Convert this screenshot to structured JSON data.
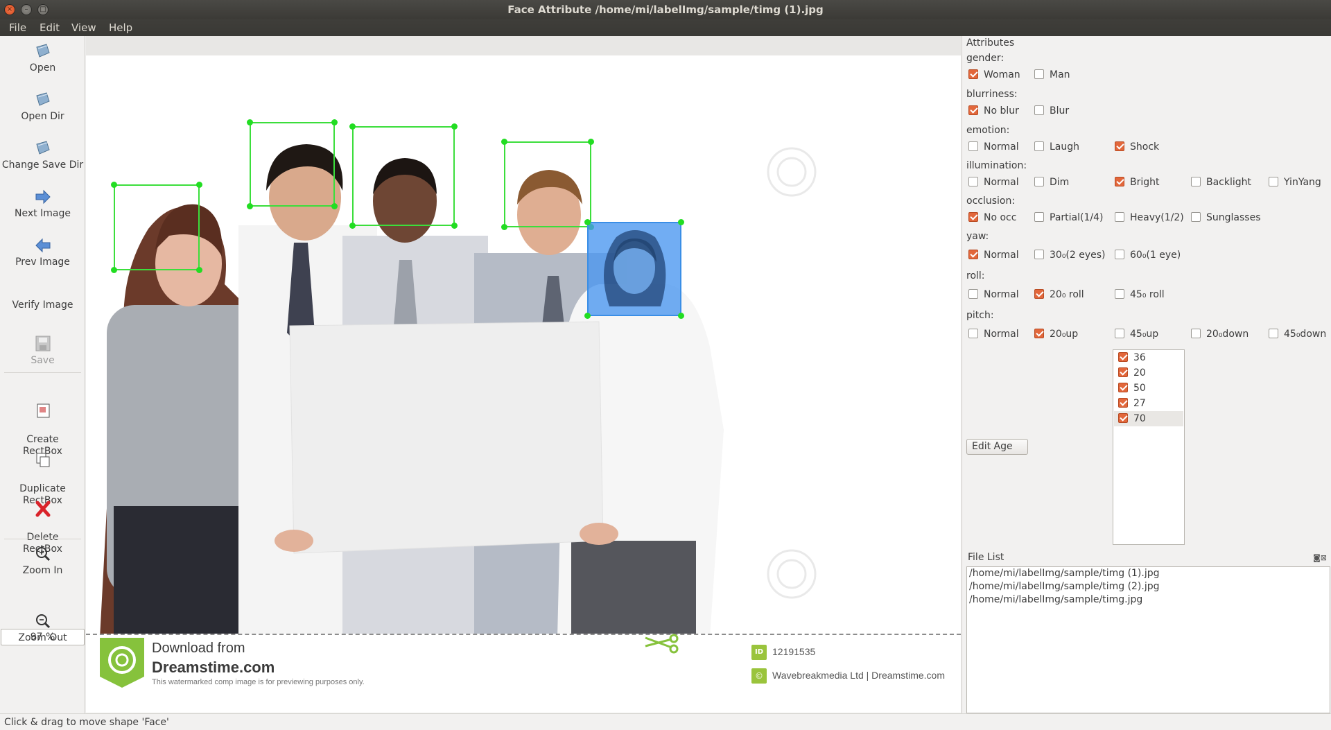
{
  "window": {
    "title": "Face Attribute /home/mi/labelImg/sample/timg (1).jpg",
    "close_glyph": "×",
    "minimize_glyph": "–",
    "maximize_glyph": "□"
  },
  "menu": {
    "file": "File",
    "edit": "Edit",
    "view": "View",
    "help": "Help"
  },
  "toolbar": {
    "open": "Open",
    "open_dir": "Open Dir",
    "change_save_dir": "Change Save Dir",
    "next_image": "Next Image",
    "prev_image": "Prev Image",
    "verify_image": "Verify Image",
    "save": "Save",
    "create_rectbox": "Create\nRectBox",
    "duplicate_rectbox": "Duplicate\nRectBox",
    "delete_rectbox": "Delete\nRectBox",
    "zoom_in": "Zoom In",
    "zoom_value": "97 %",
    "zoom_out": "Zoom Out",
    "extension_glyph": "⌄"
  },
  "canvas": {
    "selected_shape": "Face",
    "banner": {
      "download_from": "Download from",
      "site": "Dreamstime.com",
      "notice": "This watermarked comp image is for previewing purposes only.",
      "id_tag": "ID",
      "id_number": "12191535",
      "copyright_glyph": "©",
      "credit": "Wavebreakmedia Ltd | Dreamstime.com"
    }
  },
  "attributes": {
    "title": "Attributes",
    "gender": {
      "label": "gender:",
      "woman": "Woman",
      "man": "Man",
      "woman_checked": true,
      "man_checked": false
    },
    "blurriness": {
      "label": "blurriness:",
      "no_blur": "No blur",
      "blur": "Blur",
      "no_blur_checked": true,
      "blur_checked": false
    },
    "emotion": {
      "label": "emotion:",
      "normal": "Normal",
      "laugh": "Laugh",
      "shock": "Shock",
      "checked": "Shock"
    },
    "illumination": {
      "label": "illumination:",
      "normal": "Normal",
      "dim": "Dim",
      "bright": "Bright",
      "backlight": "Backlight",
      "yinyang": "YinYang",
      "checked": "Bright"
    },
    "occlusion": {
      "label": "occlusion:",
      "no_occ": "No occ",
      "partial": "Partial(1/4)",
      "heavy": "Heavy(1/2)",
      "sunglasses": "Sunglasses",
      "checked": "No occ"
    },
    "yaw": {
      "label": "yaw:",
      "normal": "Normal",
      "thirty": "30₀(2 eyes)",
      "sixty": "60₀(1 eye)",
      "checked": "Normal"
    },
    "roll": {
      "label": "roll:",
      "normal": "Normal",
      "twenty": "20₀ roll",
      "fortyfive": "45₀ roll",
      "checked": "20₀ roll"
    },
    "pitch": {
      "label": "pitch:",
      "normal": "Normal",
      "twenty_up": "20₀up",
      "fortyfive_up": "45₀up",
      "twenty_down": "20₀down",
      "fortyfive_down": "45₀down",
      "checked": "20₀up"
    },
    "ages": [
      "36",
      "20",
      "50",
      "27",
      "70"
    ],
    "selected_age": "70",
    "edit_age_button": "Edit Age"
  },
  "file_list": {
    "title": "File List",
    "dock_icons": "◙⊠",
    "files": [
      "/home/mi/labelImg/sample/timg (1).jpg",
      "/home/mi/labelImg/sample/timg (2).jpg",
      "/home/mi/labelImg/sample/timg.jpg"
    ]
  },
  "status": {
    "message": "Click & drag to move shape 'Face'"
  },
  "colors": {
    "checkbox_on": "#e2673b",
    "bbox": "#3bde3b",
    "selected_box": "#4996f0",
    "titlebar": "#3c3b37",
    "accent_close": "#e45a2c"
  }
}
